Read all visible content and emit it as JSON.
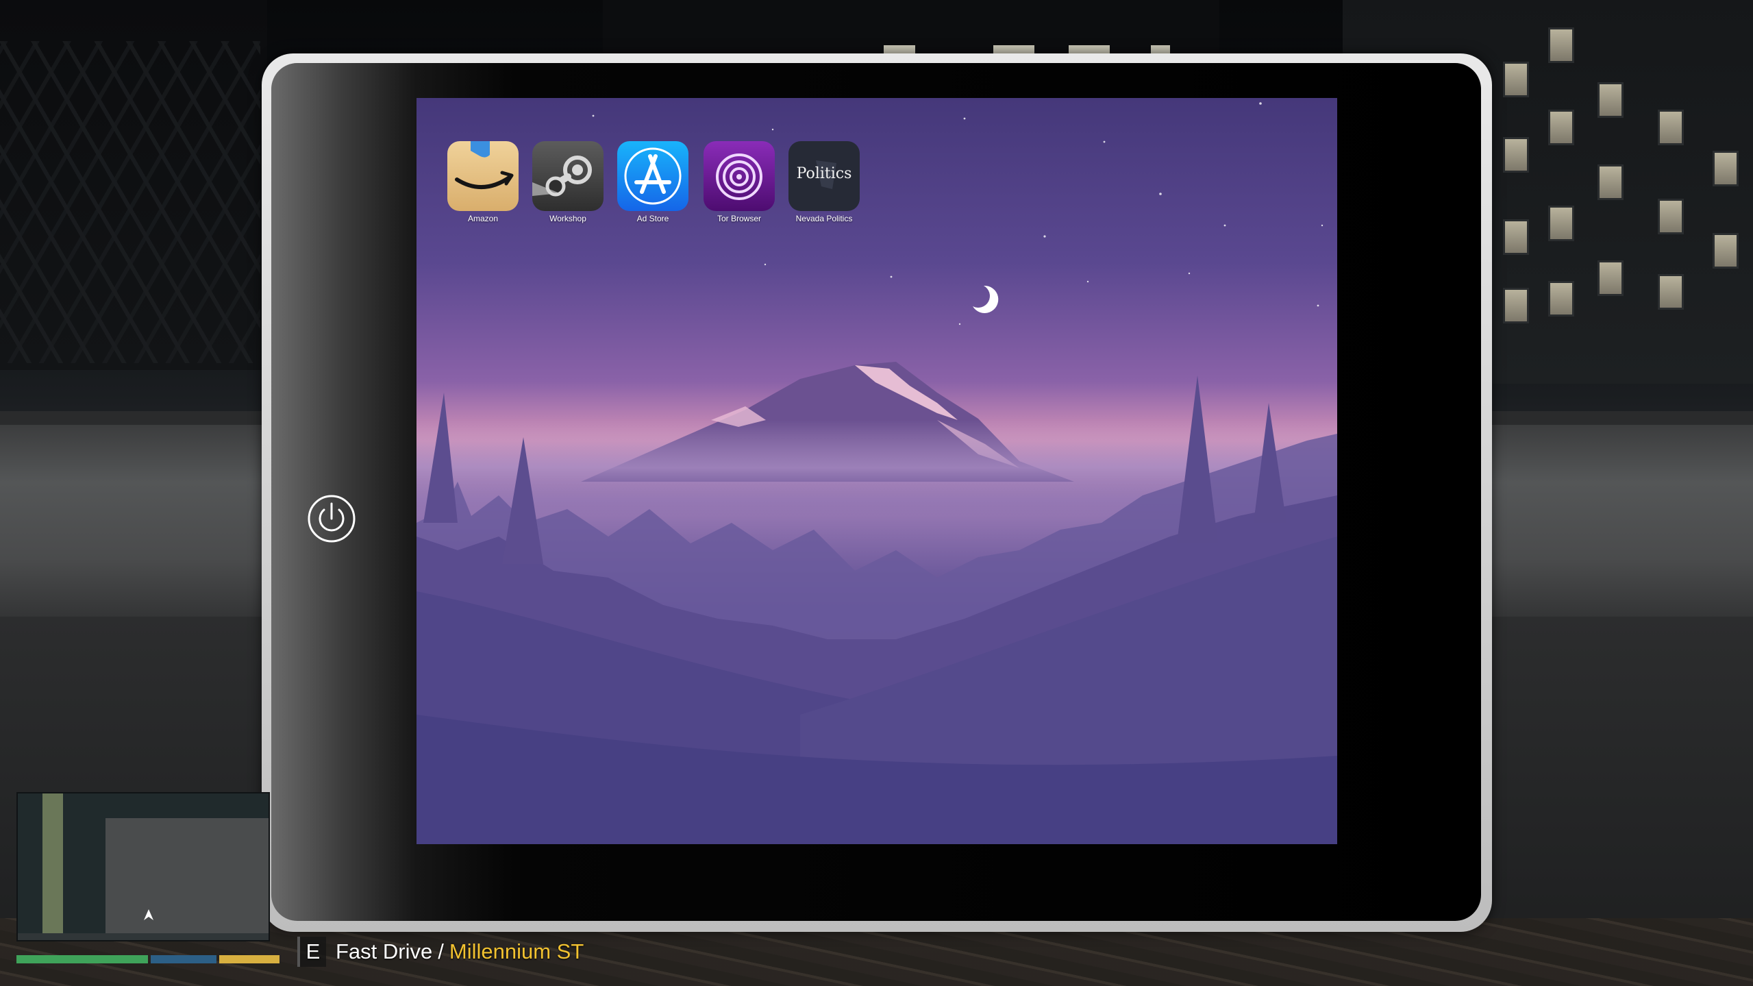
{
  "screen": {
    "width": 2559,
    "height": 1439
  },
  "tablet": {
    "power_button": {
      "icon": "power-icon"
    },
    "apps": [
      {
        "label": "Amazon",
        "icon": "amazon-icon",
        "color": "#e8c88a"
      },
      {
        "label": "Workshop",
        "icon": "steam-icon",
        "color": "#3c3c3c"
      },
      {
        "label": "Ad Store",
        "icon": "app-store-icon",
        "color": "#1e88f0"
      },
      {
        "label": "Tor Browser",
        "icon": "tor-icon",
        "color": "#6a1a90"
      },
      {
        "label": "Nevada Politics",
        "icon": "politics-icon",
        "icon_text": "Politics",
        "color": "#262a36"
      }
    ]
  },
  "hud": {
    "key": "E",
    "action": "Fast Drive",
    "separator": "/",
    "location": "Millennium ST",
    "location_color": "#f2c230"
  },
  "minimap": {
    "bars": [
      {
        "name": "health",
        "color": "#3fa35a"
      },
      {
        "name": "armor",
        "color": "#2c5f86"
      },
      {
        "name": "stamina",
        "color": "#d8b040"
      }
    ]
  }
}
